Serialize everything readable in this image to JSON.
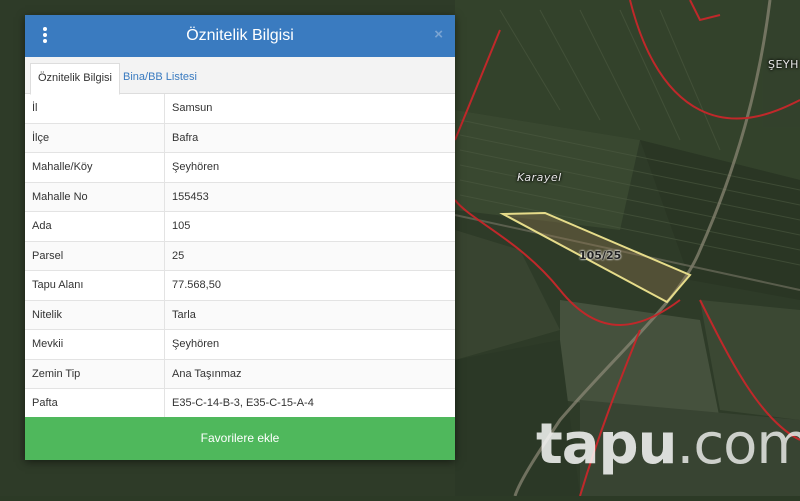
{
  "modal": {
    "title": "Öznitelik Bilgisi",
    "close_label": "×",
    "tabs": [
      {
        "label": "Öznitelik Bilgisi",
        "active": true
      },
      {
        "label": "Bina/BB Listesi",
        "active": false
      }
    ],
    "rows": [
      {
        "key": "İl",
        "value": "Samsun"
      },
      {
        "key": "İlçe",
        "value": "Bafra"
      },
      {
        "key": "Mahalle/Köy",
        "value": "Şeyhören"
      },
      {
        "key": "Mahalle No",
        "value": "155453"
      },
      {
        "key": "Ada",
        "value": "105"
      },
      {
        "key": "Parsel",
        "value": "25"
      },
      {
        "key": "Tapu Alanı",
        "value": "77.568,50"
      },
      {
        "key": "Nitelik",
        "value": "Tarla"
      },
      {
        "key": "Mevkii",
        "value": "Şeyhören"
      },
      {
        "key": "Zemin Tip",
        "value": "Ana Taşınmaz"
      },
      {
        "key": "Pafta",
        "value": "E35-C-14-B-3, E35-C-15-A-4"
      }
    ],
    "favorite_button": "Favorilere ekle"
  },
  "map": {
    "place_label": "Karayel",
    "town_label": "ŞEYH",
    "parcel_label": "105/25",
    "watermark_main": "tapu",
    "watermark_tld": ".com"
  },
  "colors": {
    "header": "#3a7bc0",
    "favorite_button": "#4fb85c",
    "parcel_outline": "#e6dc8a",
    "boundary": "#c0282a"
  }
}
